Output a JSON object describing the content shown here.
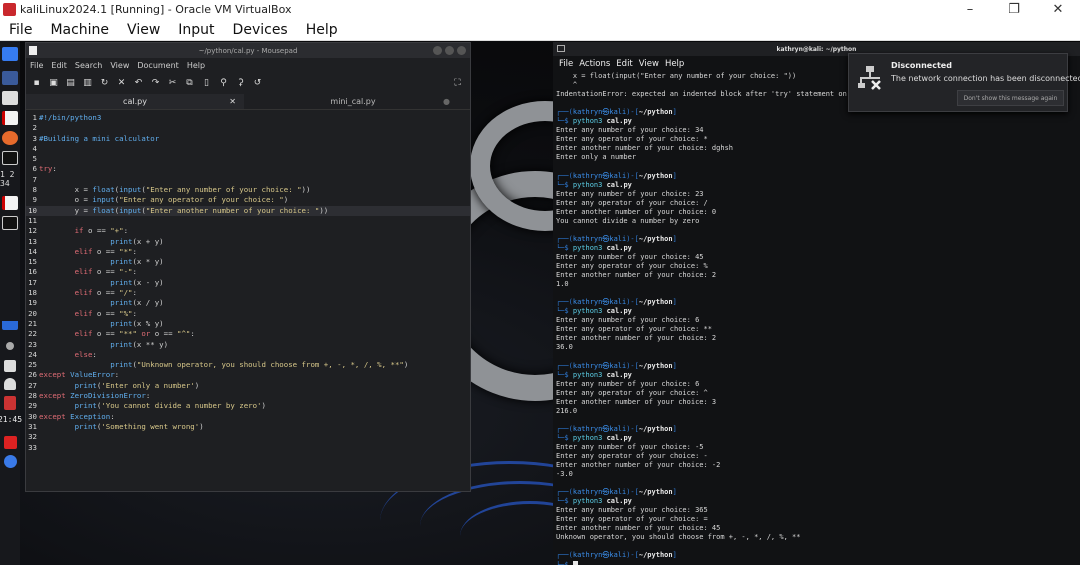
{
  "host": {
    "title": "kaliLinux2024.1 [Running] - Oracle VM VirtualBox",
    "menu": [
      "File",
      "Machine",
      "View",
      "Input",
      "Devices",
      "Help"
    ]
  },
  "dock": {
    "badge": "1 2 34",
    "clock": "21:45"
  },
  "editor": {
    "title": "~/python/cal.py - Mousepad",
    "menu": [
      "File",
      "Edit",
      "Search",
      "View",
      "Document",
      "Help"
    ],
    "tabs": [
      {
        "label": "cal.py",
        "active": true
      },
      {
        "label": "mini_cal.py",
        "active": false
      }
    ]
  },
  "terminal": {
    "title": "kathryn@kali: ~/python",
    "menu": [
      "File",
      "Actions",
      "Edit",
      "View",
      "Help"
    ]
  },
  "notification": {
    "title": "Disconnected",
    "body": "The network connection has been disconnected.",
    "button": "Don't show this message again"
  },
  "code_lines": [
    {
      "n": "1",
      "t": "#!/bin/python3"
    },
    {
      "n": "2",
      "t": ""
    },
    {
      "n": "3",
      "t": "#Building a mini calculator"
    },
    {
      "n": "4",
      "t": ""
    },
    {
      "n": "5",
      "t": ""
    },
    {
      "n": "6",
      "t": "try:"
    },
    {
      "n": "7",
      "t": ""
    },
    {
      "n": "8",
      "t": "        x = float(input(\"Enter any number of your choice: \"))"
    },
    {
      "n": "9",
      "t": "        o = input(\"Enter any operator of your choice: \")"
    },
    {
      "n": "10",
      "t": "        y = float(input(\"Enter another number of your choice: \"))"
    },
    {
      "n": "11",
      "t": ""
    },
    {
      "n": "12",
      "t": "        if o == \"+\":"
    },
    {
      "n": "13",
      "t": "                print(x + y)"
    },
    {
      "n": "14",
      "t": "        elif o == \"*\":"
    },
    {
      "n": "15",
      "t": "                print(x * y)"
    },
    {
      "n": "16",
      "t": "        elif o == \"-\":"
    },
    {
      "n": "17",
      "t": "                print(x - y)"
    },
    {
      "n": "18",
      "t": "        elif o == \"/\":"
    },
    {
      "n": "19",
      "t": "                print(x / y)"
    },
    {
      "n": "20",
      "t": "        elif o == \"%\":"
    },
    {
      "n": "21",
      "t": "                print(x % y)"
    },
    {
      "n": "22",
      "t": "        elif o == \"**\" or o == \"^\":"
    },
    {
      "n": "23",
      "t": "                print(x ** y)"
    },
    {
      "n": "24",
      "t": "        else:"
    },
    {
      "n": "25",
      "t": "                print(\"Unknown operator, you should choose from +, -, *, /, %, **\")"
    },
    {
      "n": "26",
      "t": "except ValueError:"
    },
    {
      "n": "27",
      "t": "        print('Enter only a number')"
    },
    {
      "n": "28",
      "t": "except ZeroDivisionError:"
    },
    {
      "n": "29",
      "t": "        print('You cannot divide a number by zero')"
    },
    {
      "n": "30",
      "t": "except Exception:"
    },
    {
      "n": "31",
      "t": "        print('Something went wrong')"
    },
    {
      "n": "32",
      "t": ""
    },
    {
      "n": "33",
      "t": ""
    }
  ],
  "term_lines": [
    {
      "k": "o",
      "t": "    x = float(input(\"Enter any number of your choice: \"))"
    },
    {
      "k": "o",
      "t": "    ^"
    },
    {
      "k": "o",
      "t": "IndentationError: expected an indented block after 'try' statement on line 6"
    },
    {
      "k": "o",
      "t": ""
    },
    {
      "k": "p1"
    },
    {
      "k": "p2"
    },
    {
      "k": "o",
      "t": "Enter any number of your choice: 34"
    },
    {
      "k": "o",
      "t": "Enter any operator of your choice: *"
    },
    {
      "k": "o",
      "t": "Enter another number of your choice: dghsh"
    },
    {
      "k": "o",
      "t": "Enter only a number"
    },
    {
      "k": "o",
      "t": ""
    },
    {
      "k": "p1"
    },
    {
      "k": "p2"
    },
    {
      "k": "o",
      "t": "Enter any number of your choice: 23"
    },
    {
      "k": "o",
      "t": "Enter any operator of your choice: /"
    },
    {
      "k": "o",
      "t": "Enter another number of your choice: 0"
    },
    {
      "k": "o",
      "t": "You cannot divide a number by zero"
    },
    {
      "k": "o",
      "t": ""
    },
    {
      "k": "p1"
    },
    {
      "k": "p2"
    },
    {
      "k": "o",
      "t": "Enter any number of your choice: 45"
    },
    {
      "k": "o",
      "t": "Enter any operator of your choice: %"
    },
    {
      "k": "o",
      "t": "Enter another number of your choice: 2"
    },
    {
      "k": "o",
      "t": "1.0"
    },
    {
      "k": "o",
      "t": ""
    },
    {
      "k": "p1"
    },
    {
      "k": "p2"
    },
    {
      "k": "o",
      "t": "Enter any number of your choice: 6"
    },
    {
      "k": "o",
      "t": "Enter any operator of your choice: **"
    },
    {
      "k": "o",
      "t": "Enter another number of your choice: 2"
    },
    {
      "k": "o",
      "t": "36.0"
    },
    {
      "k": "o",
      "t": ""
    },
    {
      "k": "p1"
    },
    {
      "k": "p2"
    },
    {
      "k": "o",
      "t": "Enter any number of your choice: 6"
    },
    {
      "k": "o",
      "t": "Enter any operator of your choice: ^"
    },
    {
      "k": "o",
      "t": "Enter another number of your choice: 3"
    },
    {
      "k": "o",
      "t": "216.0"
    },
    {
      "k": "o",
      "t": ""
    },
    {
      "k": "p1"
    },
    {
      "k": "p2"
    },
    {
      "k": "o",
      "t": "Enter any number of your choice: -5"
    },
    {
      "k": "o",
      "t": "Enter any operator of your choice: -"
    },
    {
      "k": "o",
      "t": "Enter another number of your choice: -2"
    },
    {
      "k": "o",
      "t": "-3.0"
    },
    {
      "k": "o",
      "t": ""
    },
    {
      "k": "p1"
    },
    {
      "k": "p2"
    },
    {
      "k": "o",
      "t": "Enter any number of your choice: 365"
    },
    {
      "k": "o",
      "t": "Enter any operator of your choice: ="
    },
    {
      "k": "o",
      "t": "Enter another number of your choice: 45"
    },
    {
      "k": "o",
      "t": "Unknown operator, you should choose from +, -, *, /, %, **"
    },
    {
      "k": "o",
      "t": ""
    },
    {
      "k": "p1"
    },
    {
      "k": "cur"
    }
  ],
  "prompt": {
    "p1_a": "┌──(",
    "user": "kathryn㉿kali",
    "p1_b": ")-[",
    "path": "~/python",
    "p1_c": "]",
    "p2_a": "└─$ ",
    "cmd": "python3",
    "arg": " cal.py"
  }
}
